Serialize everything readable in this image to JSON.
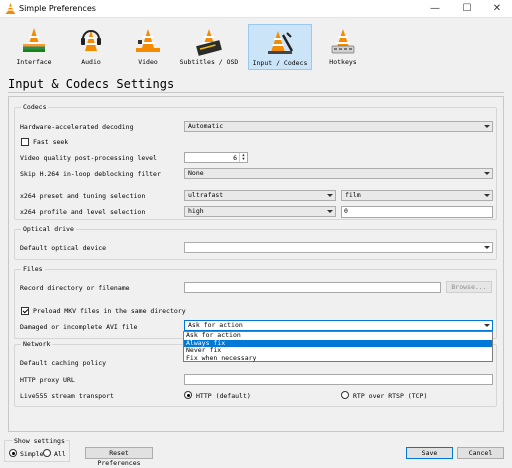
{
  "window": {
    "title": "Simple Preferences",
    "minimize": "—",
    "maximize": "☐",
    "close": "✕"
  },
  "toolbar": {
    "items": [
      {
        "label": "Interface",
        "icon": "interface-icon",
        "active": false
      },
      {
        "label": "Audio",
        "icon": "audio-icon",
        "active": false
      },
      {
        "label": "Video",
        "icon": "video-icon",
        "active": false
      },
      {
        "label": "Subtitles / OSD",
        "icon": "subtitles-icon",
        "active": false
      },
      {
        "label": "Input / Codecs",
        "icon": "input-codecs-icon",
        "active": true
      },
      {
        "label": "Hotkeys",
        "icon": "hotkeys-icon",
        "active": false
      }
    ]
  },
  "page_title": "Input & Codecs Settings",
  "codecs": {
    "title": "Codecs",
    "hw_decoding_label": "Hardware-accelerated decoding",
    "hw_decoding_value": "Automatic",
    "fast_seek_label": "Fast seek",
    "fast_seek_checked": false,
    "vq_label": "Video quality post-processing level",
    "vq_value": "6",
    "skip_label": "Skip H.264 in-loop deblocking filter",
    "skip_value": "None",
    "x264_preset_label": "x264 preset and tuning selection",
    "x264_preset_value": "ultrafast",
    "x264_tune_value": "film",
    "x264_profile_label": "x264 profile and level selection",
    "x264_profile_value": "high",
    "x264_level_value": "0"
  },
  "optical": {
    "title": "Optical drive",
    "device_label": "Default optical device",
    "device_value": ""
  },
  "files": {
    "title": "Files",
    "record_label": "Record directory or filename",
    "record_value": "",
    "browse_label": "Browse...",
    "preload_label": "Preload MKV files in the same directory",
    "preload_checked": true,
    "avi_label": "Damaged or incomplete AVI file",
    "avi_value": "Ask for action",
    "avi_options": [
      "Ask for action",
      "Always fix",
      "Never fix",
      "Fix when necessary"
    ],
    "avi_highlighted": "Always fix"
  },
  "network": {
    "title": "Network",
    "caching_label": "Default caching policy",
    "proxy_label": "HTTP proxy URL",
    "proxy_value": "",
    "live555_label": "Live555 stream transport",
    "http_label": "HTTP (default)",
    "rtp_label": "RTP over RTSP (TCP)"
  },
  "bottom": {
    "show_settings_label": "Show settings",
    "simple_label": "Simple",
    "all_label": "All",
    "reset_label": "Reset Preferences",
    "save_label": "Save",
    "cancel_label": "Cancel"
  },
  "colors": {
    "accent": "#0078d7",
    "active_tab_bg": "#cce4f7",
    "window_bg": "#f0f0f0"
  }
}
